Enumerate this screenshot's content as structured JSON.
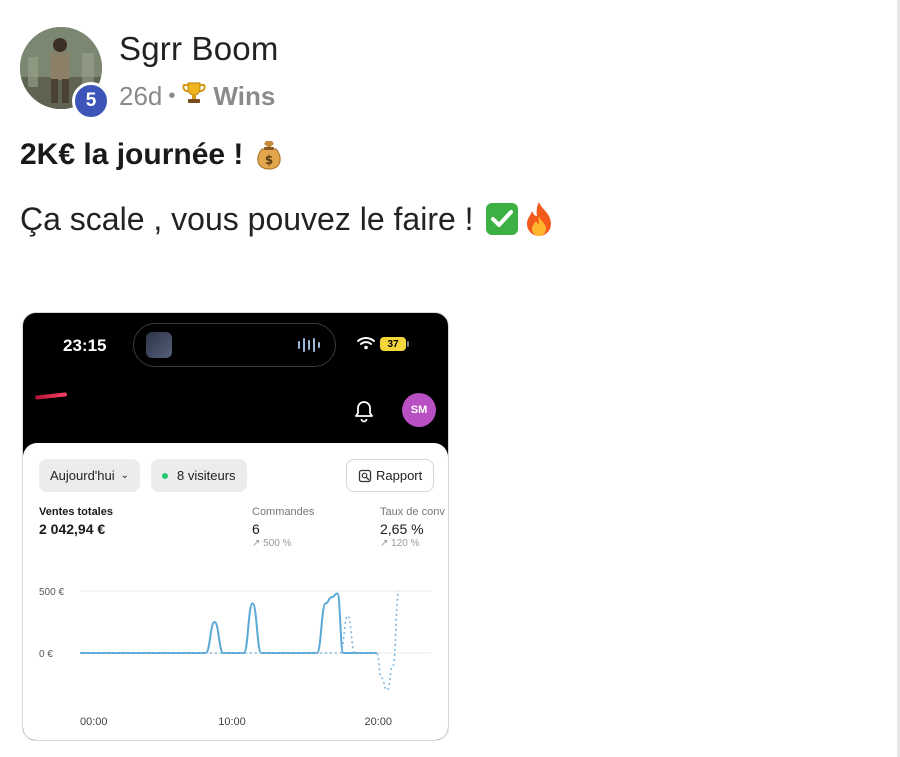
{
  "author": {
    "name": "Sgrr Boom",
    "level": "5"
  },
  "post": {
    "age": "26d",
    "separator": "•",
    "category_icon": "trophy-icon",
    "category": "Wins",
    "title": "2K€ la journée !",
    "title_emoji": "money-bag-icon",
    "body": "Ça scale , vous pouvez le faire !",
    "body_emojis": [
      "check-mark-button-icon",
      "fire-icon"
    ]
  },
  "phone": {
    "status": {
      "time": "23:15",
      "battery": "37"
    },
    "header": {
      "avatar_initials": "SM"
    },
    "filters": {
      "date": "Aujourd'hui",
      "visitors": "8 visiteurs",
      "report": "Rapport"
    },
    "stats": {
      "sales": {
        "label": "Ventes totales",
        "value": "2 042,94 €"
      },
      "orders": {
        "label": "Commandes",
        "value": "6",
        "change": "↗ 500 %"
      },
      "rate": {
        "label": "Taux de conv",
        "value": "2,65 %",
        "change": "↗ 120 %"
      }
    }
  },
  "chart_data": {
    "type": "line",
    "y_tick_labels": [
      "500 €",
      "0 €"
    ],
    "x_tick_labels": [
      "00:00",
      "10:00",
      "20:00"
    ],
    "ylim": [
      -300,
      500
    ],
    "xlim": [
      0,
      24
    ],
    "series": [
      {
        "style": "solid",
        "color": "#5aa9d6",
        "points": [
          [
            0,
            0
          ],
          [
            8.6,
            0
          ],
          [
            9.2,
            250
          ],
          [
            9.8,
            0
          ],
          [
            11.2,
            0
          ],
          [
            11.8,
            400
          ],
          [
            12.4,
            0
          ],
          [
            16.2,
            0
          ],
          [
            16.8,
            400
          ],
          [
            17.2,
            450
          ],
          [
            17.6,
            480
          ],
          [
            18.0,
            0
          ],
          [
            20.3,
            0
          ]
        ]
      },
      {
        "style": "dotted",
        "color": "#7fb8e0",
        "points": [
          [
            0,
            0
          ],
          [
            17.8,
            0
          ],
          [
            18.3,
            300
          ],
          [
            18.8,
            0
          ],
          [
            20.3,
            0
          ],
          [
            20.6,
            -200
          ],
          [
            21.0,
            -300
          ],
          [
            21.4,
            -100
          ],
          [
            21.8,
            500
          ]
        ]
      }
    ],
    "grid": true,
    "legend": "none"
  }
}
